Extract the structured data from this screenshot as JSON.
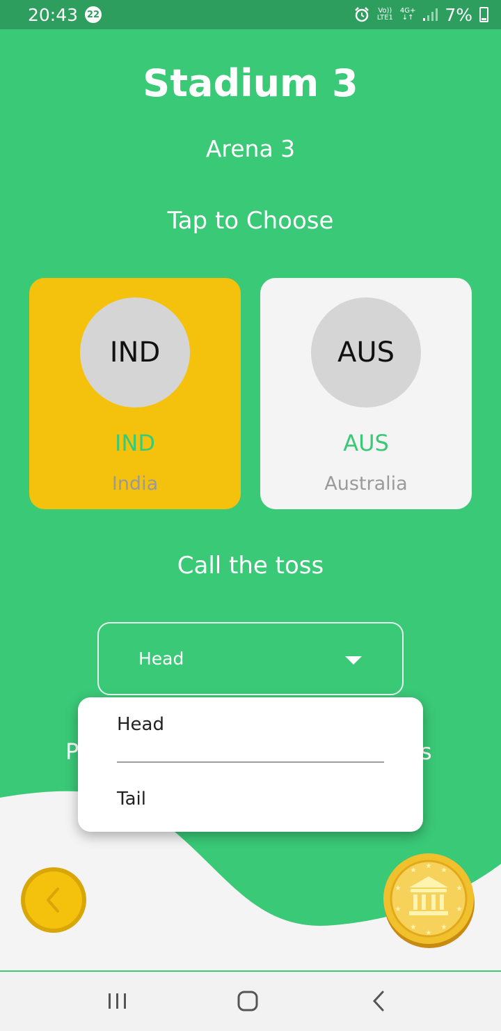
{
  "status_bar": {
    "time": "20:43",
    "notification_count": "22",
    "network_top": "Vo))",
    "network_bottom": "LTE1",
    "network_type": "4G+",
    "battery_percent": "7%"
  },
  "header": {
    "title": "Stadium 3",
    "subtitle": "Arena 3",
    "prompt": "Tap to Choose"
  },
  "teams": [
    {
      "code": "IND",
      "name": "India",
      "selected": true
    },
    {
      "code": "AUS",
      "name": "Australia",
      "selected": false
    }
  ],
  "toss": {
    "label": "Call the toss",
    "selected_value": "Head",
    "options": [
      "Head",
      "Tail"
    ]
  },
  "colors": {
    "primary_green": "#3AC977",
    "status_bar_green": "#2E9E5F",
    "selected_card_yellow": "#F4C20D",
    "card_white": "#F4F4F4",
    "coin_gold": "#F0C12C"
  },
  "icons": {
    "back": "chevron-left-icon",
    "coin": "coin-bank-icon",
    "dropdown": "caret-down-icon"
  }
}
